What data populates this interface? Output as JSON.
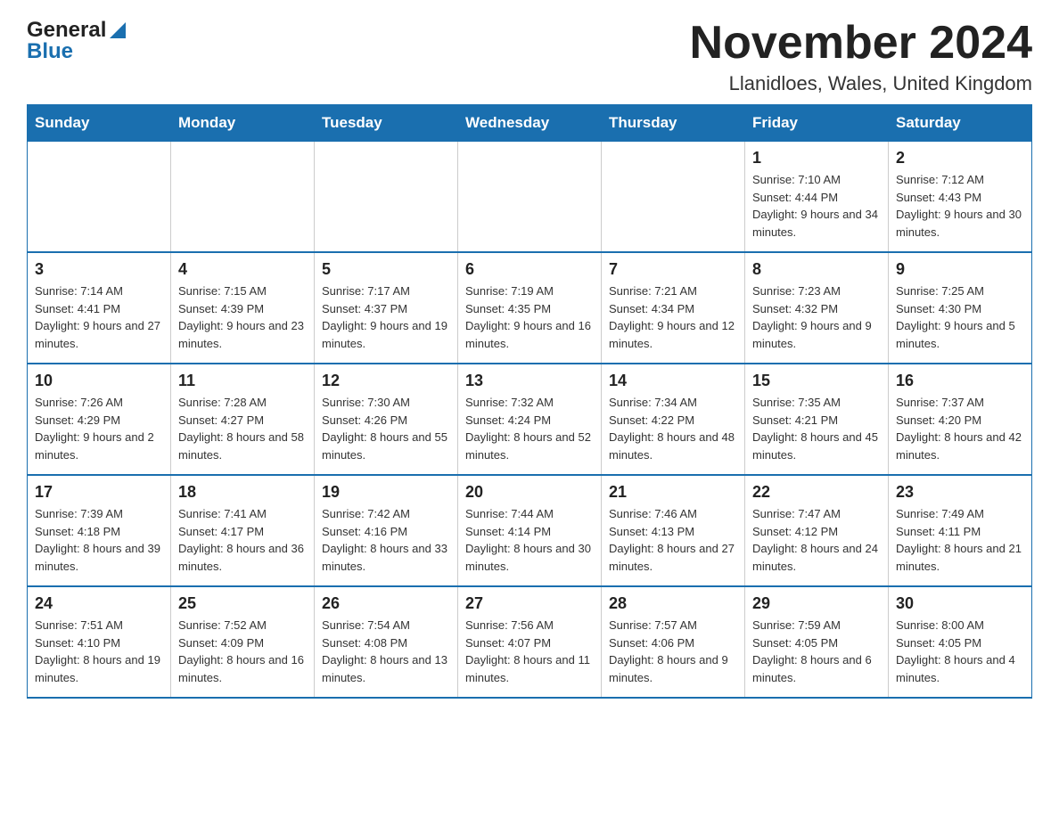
{
  "header": {
    "logo_general": "General",
    "logo_blue": "Blue",
    "title": "November 2024",
    "subtitle": "Llanidloes, Wales, United Kingdom"
  },
  "calendar": {
    "days_of_week": [
      "Sunday",
      "Monday",
      "Tuesday",
      "Wednesday",
      "Thursday",
      "Friday",
      "Saturday"
    ],
    "weeks": [
      {
        "days": [
          {
            "number": "",
            "info": "",
            "empty": true
          },
          {
            "number": "",
            "info": "",
            "empty": true
          },
          {
            "number": "",
            "info": "",
            "empty": true
          },
          {
            "number": "",
            "info": "",
            "empty": true
          },
          {
            "number": "",
            "info": "",
            "empty": true
          },
          {
            "number": "1",
            "info": "Sunrise: 7:10 AM\nSunset: 4:44 PM\nDaylight: 9 hours and 34 minutes.",
            "empty": false
          },
          {
            "number": "2",
            "info": "Sunrise: 7:12 AM\nSunset: 4:43 PM\nDaylight: 9 hours and 30 minutes.",
            "empty": false
          }
        ]
      },
      {
        "days": [
          {
            "number": "3",
            "info": "Sunrise: 7:14 AM\nSunset: 4:41 PM\nDaylight: 9 hours and 27 minutes.",
            "empty": false
          },
          {
            "number": "4",
            "info": "Sunrise: 7:15 AM\nSunset: 4:39 PM\nDaylight: 9 hours and 23 minutes.",
            "empty": false
          },
          {
            "number": "5",
            "info": "Sunrise: 7:17 AM\nSunset: 4:37 PM\nDaylight: 9 hours and 19 minutes.",
            "empty": false
          },
          {
            "number": "6",
            "info": "Sunrise: 7:19 AM\nSunset: 4:35 PM\nDaylight: 9 hours and 16 minutes.",
            "empty": false
          },
          {
            "number": "7",
            "info": "Sunrise: 7:21 AM\nSunset: 4:34 PM\nDaylight: 9 hours and 12 minutes.",
            "empty": false
          },
          {
            "number": "8",
            "info": "Sunrise: 7:23 AM\nSunset: 4:32 PM\nDaylight: 9 hours and 9 minutes.",
            "empty": false
          },
          {
            "number": "9",
            "info": "Sunrise: 7:25 AM\nSunset: 4:30 PM\nDaylight: 9 hours and 5 minutes.",
            "empty": false
          }
        ]
      },
      {
        "days": [
          {
            "number": "10",
            "info": "Sunrise: 7:26 AM\nSunset: 4:29 PM\nDaylight: 9 hours and 2 minutes.",
            "empty": false
          },
          {
            "number": "11",
            "info": "Sunrise: 7:28 AM\nSunset: 4:27 PM\nDaylight: 8 hours and 58 minutes.",
            "empty": false
          },
          {
            "number": "12",
            "info": "Sunrise: 7:30 AM\nSunset: 4:26 PM\nDaylight: 8 hours and 55 minutes.",
            "empty": false
          },
          {
            "number": "13",
            "info": "Sunrise: 7:32 AM\nSunset: 4:24 PM\nDaylight: 8 hours and 52 minutes.",
            "empty": false
          },
          {
            "number": "14",
            "info": "Sunrise: 7:34 AM\nSunset: 4:22 PM\nDaylight: 8 hours and 48 minutes.",
            "empty": false
          },
          {
            "number": "15",
            "info": "Sunrise: 7:35 AM\nSunset: 4:21 PM\nDaylight: 8 hours and 45 minutes.",
            "empty": false
          },
          {
            "number": "16",
            "info": "Sunrise: 7:37 AM\nSunset: 4:20 PM\nDaylight: 8 hours and 42 minutes.",
            "empty": false
          }
        ]
      },
      {
        "days": [
          {
            "number": "17",
            "info": "Sunrise: 7:39 AM\nSunset: 4:18 PM\nDaylight: 8 hours and 39 minutes.",
            "empty": false
          },
          {
            "number": "18",
            "info": "Sunrise: 7:41 AM\nSunset: 4:17 PM\nDaylight: 8 hours and 36 minutes.",
            "empty": false
          },
          {
            "number": "19",
            "info": "Sunrise: 7:42 AM\nSunset: 4:16 PM\nDaylight: 8 hours and 33 minutes.",
            "empty": false
          },
          {
            "number": "20",
            "info": "Sunrise: 7:44 AM\nSunset: 4:14 PM\nDaylight: 8 hours and 30 minutes.",
            "empty": false
          },
          {
            "number": "21",
            "info": "Sunrise: 7:46 AM\nSunset: 4:13 PM\nDaylight: 8 hours and 27 minutes.",
            "empty": false
          },
          {
            "number": "22",
            "info": "Sunrise: 7:47 AM\nSunset: 4:12 PM\nDaylight: 8 hours and 24 minutes.",
            "empty": false
          },
          {
            "number": "23",
            "info": "Sunrise: 7:49 AM\nSunset: 4:11 PM\nDaylight: 8 hours and 21 minutes.",
            "empty": false
          }
        ]
      },
      {
        "days": [
          {
            "number": "24",
            "info": "Sunrise: 7:51 AM\nSunset: 4:10 PM\nDaylight: 8 hours and 19 minutes.",
            "empty": false
          },
          {
            "number": "25",
            "info": "Sunrise: 7:52 AM\nSunset: 4:09 PM\nDaylight: 8 hours and 16 minutes.",
            "empty": false
          },
          {
            "number": "26",
            "info": "Sunrise: 7:54 AM\nSunset: 4:08 PM\nDaylight: 8 hours and 13 minutes.",
            "empty": false
          },
          {
            "number": "27",
            "info": "Sunrise: 7:56 AM\nSunset: 4:07 PM\nDaylight: 8 hours and 11 minutes.",
            "empty": false
          },
          {
            "number": "28",
            "info": "Sunrise: 7:57 AM\nSunset: 4:06 PM\nDaylight: 8 hours and 9 minutes.",
            "empty": false
          },
          {
            "number": "29",
            "info": "Sunrise: 7:59 AM\nSunset: 4:05 PM\nDaylight: 8 hours and 6 minutes.",
            "empty": false
          },
          {
            "number": "30",
            "info": "Sunrise: 8:00 AM\nSunset: 4:05 PM\nDaylight: 8 hours and 4 minutes.",
            "empty": false
          }
        ]
      }
    ]
  }
}
